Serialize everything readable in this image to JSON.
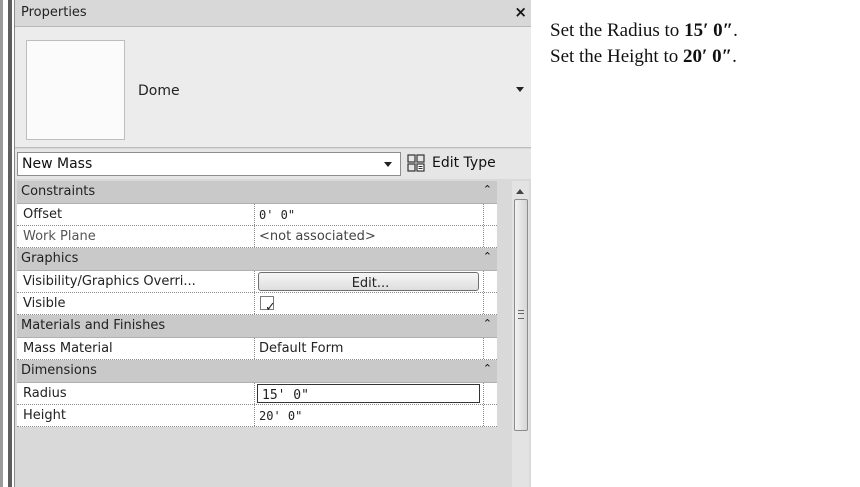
{
  "panel": {
    "title": "Properties",
    "close": "×",
    "type_name": "Dome",
    "instance_select": "New Mass",
    "edit_type_label": "Edit Type"
  },
  "sections": [
    {
      "label": "Constraints",
      "collapse": "⌃"
    },
    {
      "label": "Graphics",
      "collapse": "⌃"
    },
    {
      "label": "Materials and Finishes",
      "collapse": "⌃"
    },
    {
      "label": "Dimensions",
      "collapse": "⌃"
    }
  ],
  "rows": {
    "offset": {
      "name": "Offset",
      "value": "0'  0\""
    },
    "work_plane": {
      "name": "Work Plane",
      "value": "<not associated>"
    },
    "vis_graphics": {
      "name": "Visibility/Graphics Overri...",
      "button": "Edit..."
    },
    "visible": {
      "name": "Visible",
      "check": "✓"
    },
    "mass_material": {
      "name": "Mass Material",
      "value": "Default Form"
    },
    "radius": {
      "name": "Radius",
      "value": "15'  0\""
    },
    "height": {
      "name": "Height",
      "value": "20'  0\""
    }
  },
  "instructions": {
    "line1_prefix": "Set the Radius to ",
    "line1_value": "15′ 0″",
    "line1_suffix": ".",
    "line2_prefix": "Set the Height to ",
    "line2_value": "20′ 0″",
    "line2_suffix": "."
  },
  "colors": {
    "panel_bg": "#d9d9d9",
    "section_bg": "#c9c9c9",
    "row_bg": "#ffffff"
  }
}
